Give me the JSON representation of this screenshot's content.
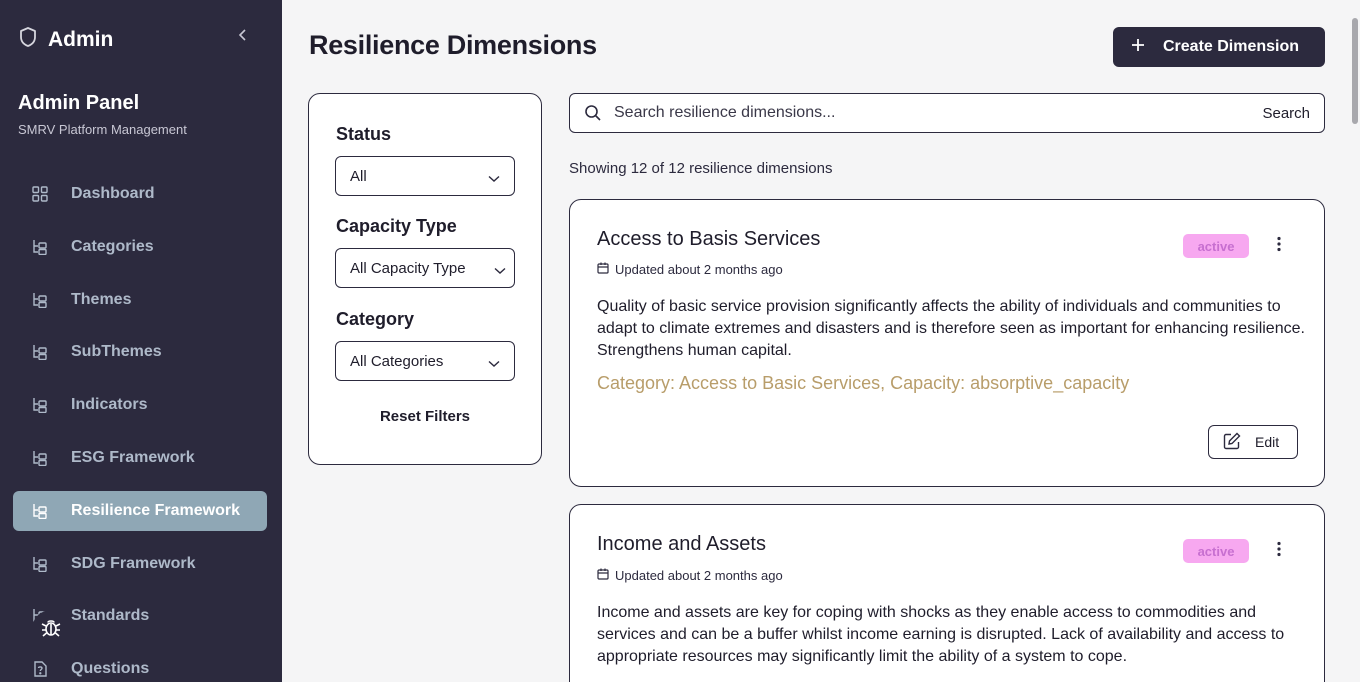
{
  "sidebar": {
    "brand": "Admin",
    "panel_title": "Admin Panel",
    "panel_subtitle": "SMRV Platform Management",
    "items": [
      {
        "label": "Dashboard",
        "icon": "grid-icon"
      },
      {
        "label": "Categories",
        "icon": "tree-icon"
      },
      {
        "label": "Themes",
        "icon": "tree-icon"
      },
      {
        "label": "SubThemes",
        "icon": "tree-icon"
      },
      {
        "label": "Indicators",
        "icon": "tree-icon"
      },
      {
        "label": "ESG Framework",
        "icon": "tree-icon"
      },
      {
        "label": "Resilience Framework",
        "icon": "tree-icon",
        "active": true
      },
      {
        "label": "SDG Framework",
        "icon": "tree-icon"
      },
      {
        "label": "Standards",
        "icon": "tree-icon"
      },
      {
        "label": "Questions",
        "icon": "help-icon"
      }
    ]
  },
  "header": {
    "title": "Resilience Dimensions",
    "create_label": "Create Dimension"
  },
  "filters": {
    "status_label": "Status",
    "status_value": "All",
    "capacity_label": "Capacity Type",
    "capacity_value": "All Capacity Type",
    "category_label": "Category",
    "category_value": "All Categories",
    "reset_label": "Reset Filters"
  },
  "search": {
    "placeholder": "Search resilience dimensions...",
    "button_label": "Search"
  },
  "results_text": "Showing 12 of 12 resilience dimensions",
  "cards": [
    {
      "title": "Access to Basis Services",
      "updated": "Updated about 2 months ago",
      "status": "active",
      "description": "Quality of basic service provision significantly affects the ability of individuals and communities to adapt to climate extremes and disasters and is therefore seen as important for enhancing resilience. Strengthens human capital.",
      "meta": "Category: Access to Basic Services, Capacity: absorptive_capacity",
      "edit_label": "Edit"
    },
    {
      "title": "Income and Assets",
      "updated": "Updated about 2 months ago",
      "status": "active",
      "description": "Income and assets are key for coping with shocks as they enable access to commodities and services and can be a buffer whilst income earning is disrupted. Lack of availability and access to appropriate resources may significantly limit the ability of a system to cope."
    }
  ],
  "colors": {
    "sidebar_bg": "#2c2a3e",
    "active_nav": "#8fa7b5",
    "badge_bg": "#f7a8f0",
    "meta_text": "#b89d6a"
  }
}
